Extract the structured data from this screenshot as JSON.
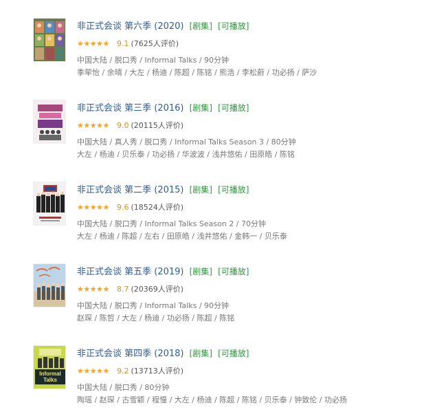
{
  "results": [
    {
      "title": "非正式会谈 第六季 (2020)",
      "tag_type": "[剧集]",
      "tag_play": "[可播放]",
      "rating_fraction": 0.9,
      "score": "9.1",
      "count": "(7625人评价)",
      "meta": "中国大陆 / 脱口秀 / Informal Talks / 90分钟",
      "cast": "季荦怡 / 余晴 / 大左 / 杨迪 / 陈超 / 陈铭 / 熊浩 / 李松蔚 / 功必扬 / 萨沙"
    },
    {
      "title": "非正式会谈 第三季 (2016)",
      "tag_type": "[剧集]",
      "tag_play": "[可播放]",
      "rating_fraction": 0.9,
      "score": "9.0",
      "count": "(20115人评价)",
      "meta": "中国大陆 / 真人秀 / 脱口秀 / Informal Talks Season 3 / 80分钟",
      "cast": "大左 / 杨迪 / 贝乐泰 / 功必扬 / 华波波 / 浅井悠佑 / 田原皓 / 陈铭"
    },
    {
      "title": "非正式会谈 第二季 (2015)",
      "tag_type": "[剧集]",
      "tag_play": "[可播放]",
      "rating_fraction": 1.0,
      "score": "9.6",
      "count": "(18524人评价)",
      "meta": "中国大陆 / 脱口秀 / Informal Talks Season 2 / 70分钟",
      "cast": "大左 / 杨迪 / 陈超 / 左右 / 田原皓 / 浅井悠佑 / 金韩一 / 贝乐泰"
    },
    {
      "title": "非正式会谈 第五季 (2019)",
      "tag_type": "[剧集]",
      "tag_play": "[可播放]",
      "rating_fraction": 0.9,
      "score": "8.7",
      "count": "(20369人评价)",
      "meta": "中国大陆 / 脱口秀 / Informal Talks / 90分钟",
      "cast": "赵琛 / 陈哲 / 大左 / 杨迪 / 功必扬 / 陈超 / 陈铭"
    },
    {
      "title": "非正式会谈 第四季 (2018)",
      "tag_type": "[剧集]",
      "tag_play": "[可播放]",
      "rating_fraction": 0.9,
      "score": "9.2",
      "count": "(13713人评价)",
      "meta": "中国大陆 / 脱口秀 / 80分钟",
      "cast": "陶瑶 / 赵琛 / 古雪颖 / 程憧 / 大左 / 杨迪 / 陈超 / 陈铭 / 贝乐泰 / 钟致伦 / 功必扬",
      "cover_text": "Informal Talks"
    }
  ],
  "stars_glyph": "★★★★★",
  "colors": {
    "title_link": "#2e5d9b",
    "tag": "#2e963d",
    "star": "#f4a627",
    "score": "#e09015"
  }
}
